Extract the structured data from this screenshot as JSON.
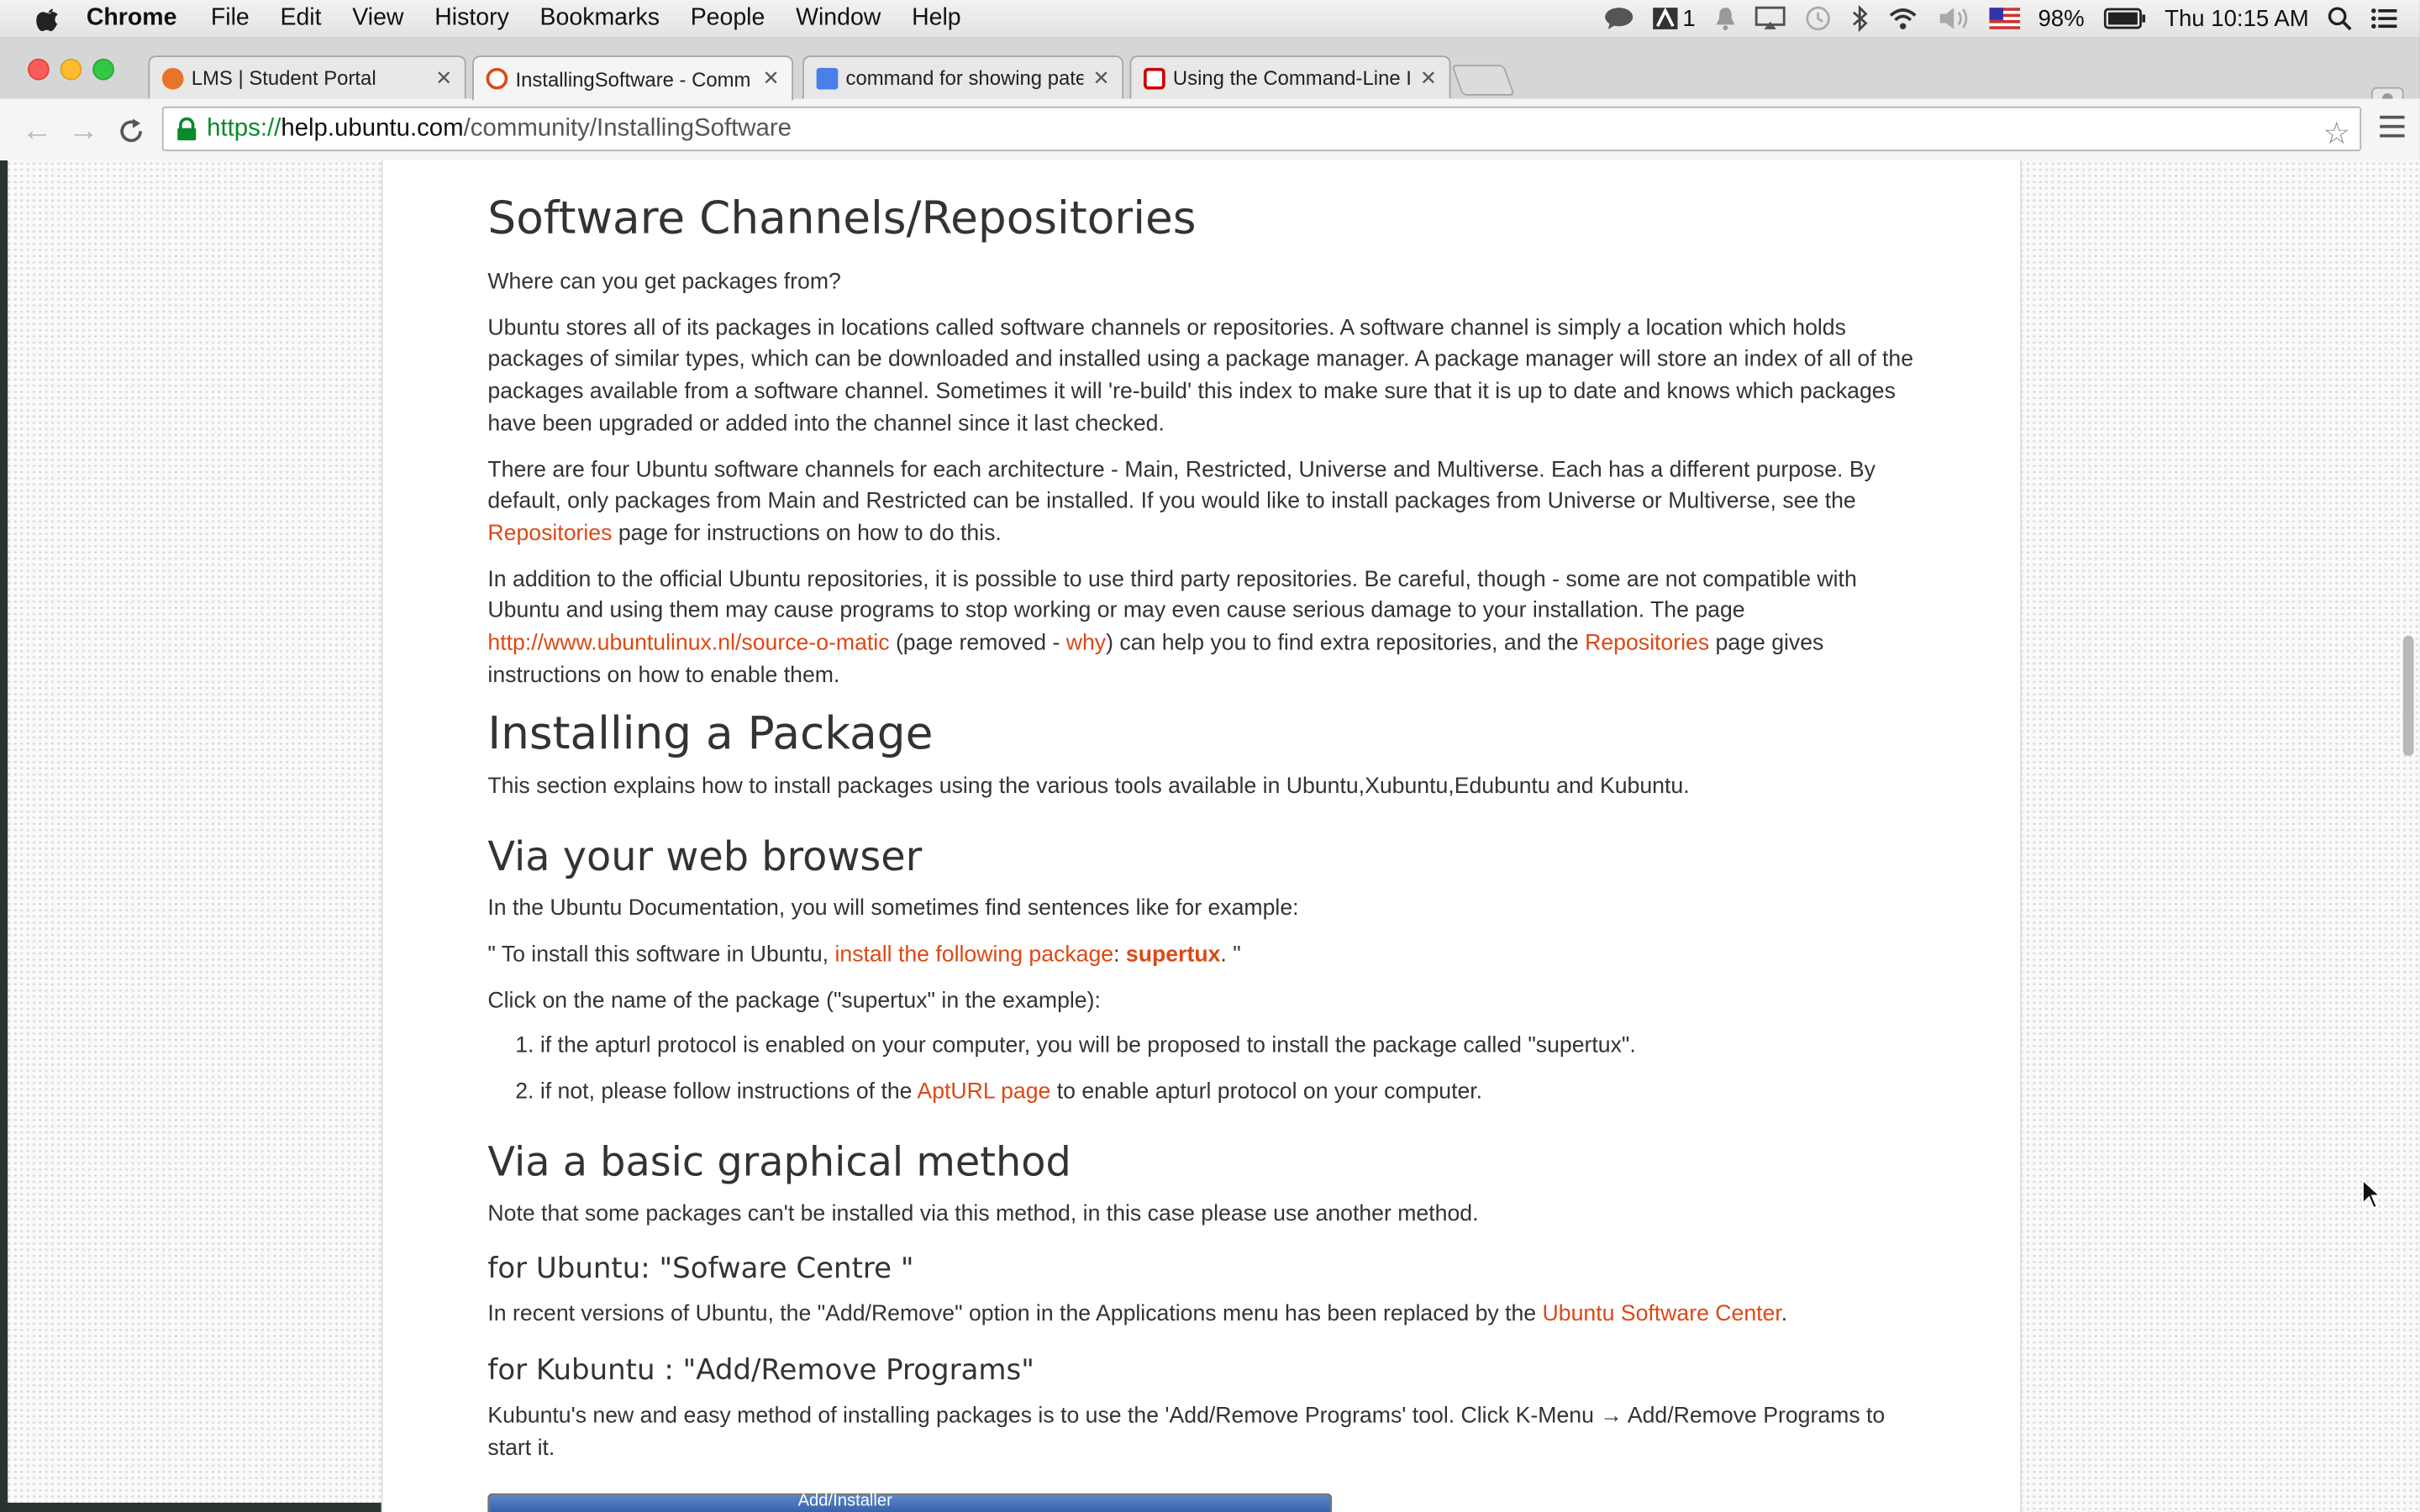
{
  "menubar": {
    "app": "Chrome",
    "items": [
      "File",
      "Edit",
      "View",
      "History",
      "Bookmarks",
      "People",
      "Window",
      "Help"
    ],
    "status": {
      "notifications_count": "1",
      "battery": "98%",
      "clock": "Thu 10:15 AM"
    }
  },
  "tabs": [
    {
      "title": "LMS | Student Portal",
      "favicon_color": "#e8732a",
      "active": false
    },
    {
      "title": "InstallingSoftware - Comm",
      "favicon_color": "#dd4814",
      "active": true
    },
    {
      "title": "command for showing pate",
      "favicon_color": "#4a7ee8",
      "active": false
    },
    {
      "title": "Using the Command-Line I",
      "favicon_color": "#cc0000",
      "active": false
    }
  ],
  "toolbar": {
    "url_scheme": "https://",
    "url_host": "help.ubuntu.com",
    "url_path": "/community/InstallingSoftware"
  },
  "content": {
    "h_channels": "Software Channels/Repositories",
    "p_where": "Where can you get packages from?",
    "p_stores": "Ubuntu stores all of its packages in locations called software channels or repositories. A software channel is simply a location which holds packages of similar types, which can be downloaded and installed using a package manager. A package manager will store an index of all of the packages available from a software channel. Sometimes it will 're-build' this index to make sure that it is up to date and knows which packages have been upgraded or added into the channel since it last checked.",
    "p_four_a": "There are four Ubuntu software channels for each architecture - Main, Restricted, Universe and Multiverse. Each has a different purpose. By default, only packages from Main and Restricted can be installed. If you would like to install packages from Universe or Multiverse, see the ",
    "p_four_link": "Repositories",
    "p_four_b": " page for instructions on how to do this.",
    "p_third_a": "In addition to the official Ubuntu repositories, it is possible to use third party repositories. Be careful, though - some are not compatible with Ubuntu and using them may cause programs to stop working or may even cause serious damage to your installation. The page ",
    "p_third_link1": "http://www.ubuntulinux.nl/source-o-matic",
    "p_third_b": " (page removed - ",
    "p_third_link2": "why",
    "p_third_c": ") can help you to find extra repositories, and the ",
    "p_third_link3": "Repositories",
    "p_third_d": " page gives instructions on how to enable them.",
    "h_installing": "Installing a Package",
    "p_section": "This section explains how to install packages using the various tools available in Ubuntu,Xubuntu,Edubuntu and Kubuntu.",
    "h_web": "Via your web browser",
    "p_doc": "In the Ubuntu Documentation, you will sometimes find sentences like for example:",
    "p_quote_a": "\" To install this software in Ubuntu, ",
    "p_quote_link": "install the following package",
    "p_quote_colon": ": ",
    "p_quote_pkg": "supertux",
    "p_quote_b": ". \"",
    "p_click": "Click on the name of the package (\"supertux\" in the example):",
    "li1": "if the apturl protocol is enabled on your computer, you will be proposed to install the package called \"supertux\".",
    "li2_a": "if not, please follow instructions of the ",
    "li2_link": "AptURL page",
    "li2_b": " to enable apturl protocol on your computer.",
    "h_graphical": "Via a basic graphical method",
    "p_note": "Note that some packages can't be installed via this method, in this case please use another method.",
    "h_ubuntu": "for Ubuntu: \"Sofware Centre \"",
    "p_recent_a": "In recent versions of Ubuntu, the \"Add/Remove\" option in the Applications menu has been replaced by the ",
    "p_recent_link": "Ubuntu Software Center",
    "p_recent_b": ".",
    "h_kubuntu": "for Kubuntu : \"Add/Remove Programs\"",
    "p_kubuntu": "Kubuntu's new and easy method of installing packages is to use the 'Add/Remove Programs' tool. Click K-Menu → Add/Remove Programs to start it.",
    "img_caption": "Add/Installer"
  }
}
